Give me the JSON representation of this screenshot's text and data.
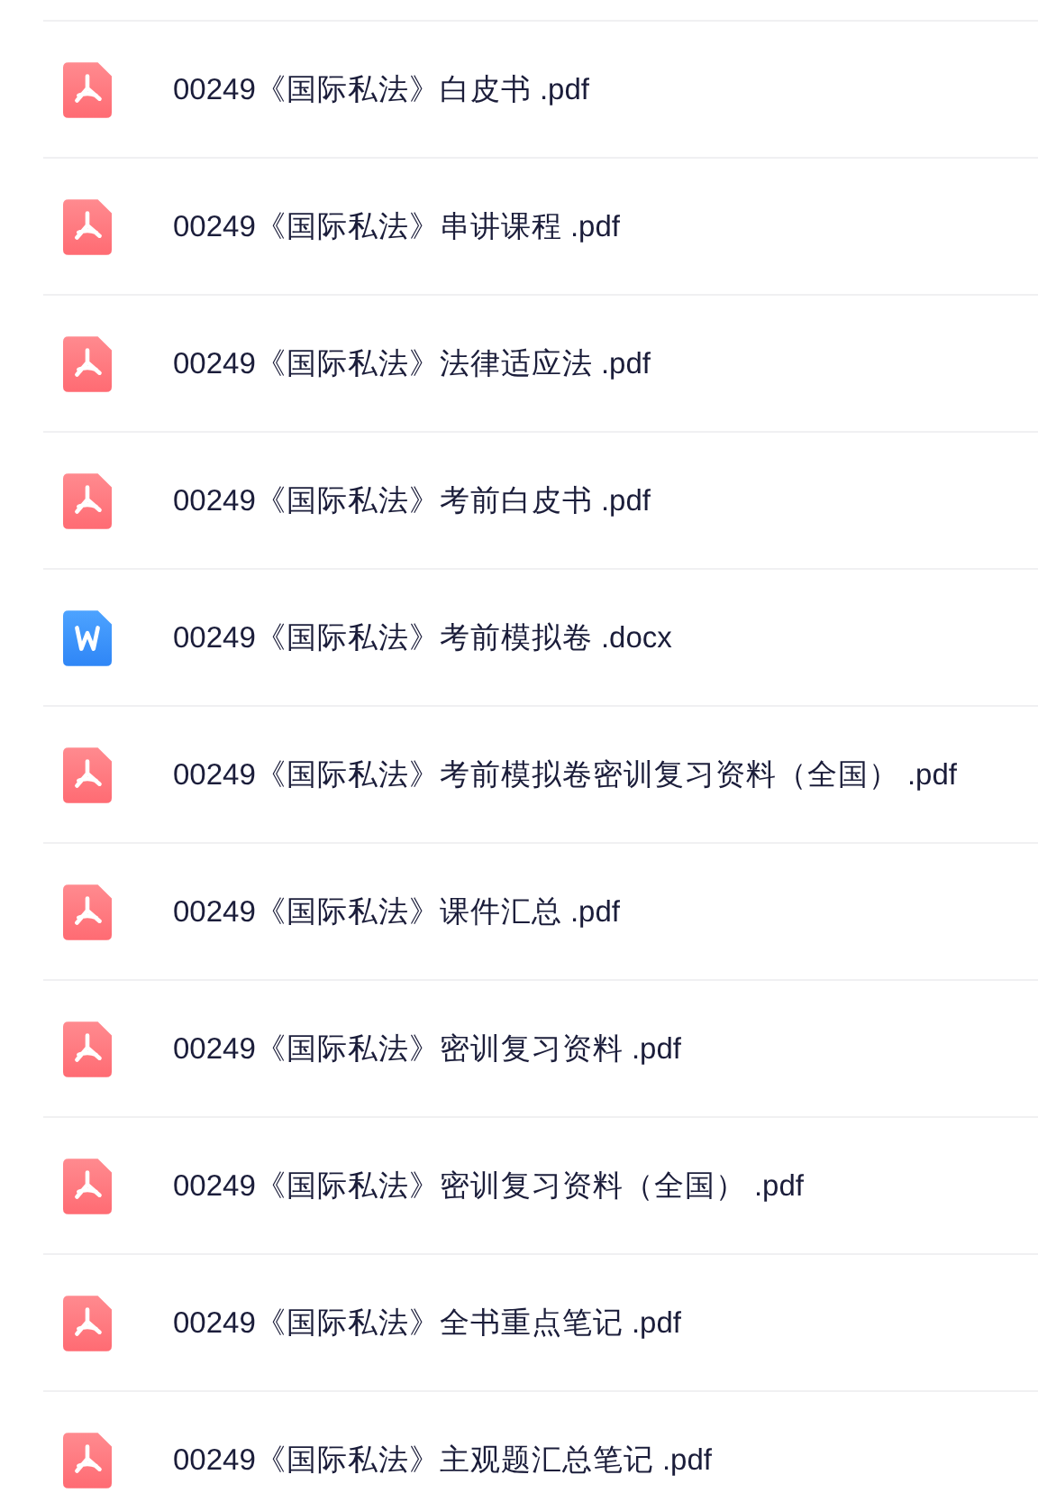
{
  "files": [
    {
      "kind": "pdf",
      "name": "00249《国际私法》白皮书 .pdf"
    },
    {
      "kind": "pdf",
      "name": "00249《国际私法》串讲课程 .pdf"
    },
    {
      "kind": "pdf",
      "name": "00249《国际私法》法律适应法 .pdf"
    },
    {
      "kind": "pdf",
      "name": "00249《国际私法》考前白皮书 .pdf"
    },
    {
      "kind": "word",
      "name": "00249《国际私法》考前模拟卷 .docx"
    },
    {
      "kind": "pdf",
      "name": "00249《国际私法》考前模拟卷密训复习资料（全国） .pdf"
    },
    {
      "kind": "pdf",
      "name": "00249《国际私法》课件汇总 .pdf"
    },
    {
      "kind": "pdf",
      "name": "00249《国际私法》密训复习资料 .pdf"
    },
    {
      "kind": "pdf",
      "name": "00249《国际私法》密训复习资料（全国） .pdf"
    },
    {
      "kind": "pdf",
      "name": "00249《国际私法》全书重点笔记 .pdf"
    },
    {
      "kind": "pdf",
      "name": "00249《国际私法》主观题汇总笔记 .pdf"
    }
  ]
}
